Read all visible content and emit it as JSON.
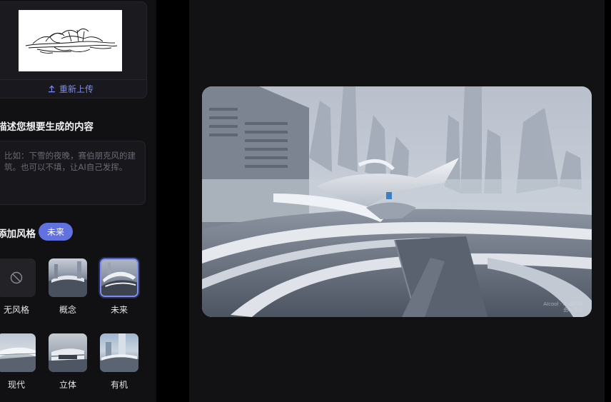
{
  "upload": {
    "reupload_label": "重新上传"
  },
  "prompt": {
    "title": "描述您想要生成的内容",
    "placeholder": "比如：下雪的夜晚，赛伯朋克风的建筑。也可以不填，让AI自己发挥。"
  },
  "style": {
    "title": "添加风格",
    "selected_tag": "未来",
    "items": [
      {
        "label": "无风格",
        "icon": "ban-icon"
      },
      {
        "label": "概念"
      },
      {
        "label": "未来",
        "selected": true
      },
      {
        "label": "现代"
      },
      {
        "label": "立体"
      },
      {
        "label": "有机"
      }
    ]
  },
  "result": {
    "watermark": "AIcool · AI编辑器\n由AI生成"
  },
  "colors": {
    "accent": "#6271e0",
    "accent_border": "#7d8cf0",
    "panel": "#111113",
    "canvas": "#121214"
  }
}
